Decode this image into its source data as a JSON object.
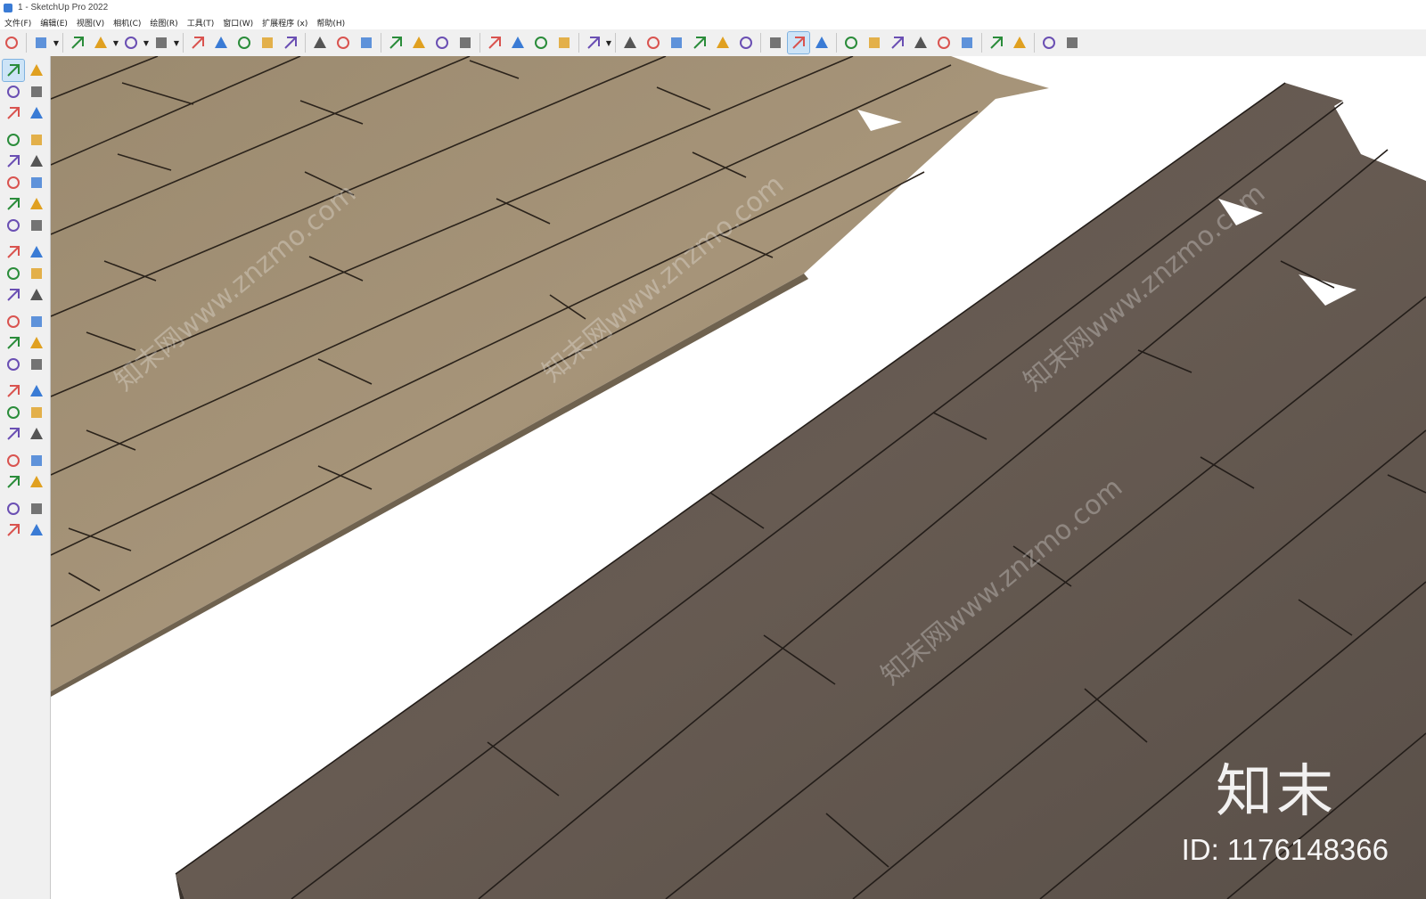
{
  "window": {
    "title": "1 - SketchUp Pro 2022"
  },
  "menu": [
    "文件(F)",
    "编辑(E)",
    "视图(V)",
    "相机(C)",
    "绘图(R)",
    "工具(T)",
    "窗口(W)",
    "扩展程序 (x)",
    "帮助(H)"
  ],
  "toolbar_icons": [
    "search-icon",
    "select-icon",
    "eraser-icon",
    "pencil-icon",
    "arc-icon",
    "rectangle-icon",
    "push-pull-icon",
    "follow-me-icon",
    "move-icon",
    "rotate-icon",
    "scale-icon",
    "tape-measure-icon",
    "text-icon",
    "paint-bucket-icon",
    "orbit-icon",
    "pan-icon",
    "zoom-icon",
    "zoom-extents-icon",
    "warehouse-icon",
    "extension-icon",
    "layers-icon",
    "styles-icon",
    "account-icon",
    "iso-view-icon",
    "front-view-icon",
    "home-view-icon",
    "top-view-icon",
    "right-view-icon",
    "back-view-icon",
    "component-icon",
    "section-icon",
    "scenes-icon",
    "add-icon",
    "solid-icon",
    "materials-icon",
    "checker-icon",
    "cloud-icon",
    "settings-icon",
    "outliner-icon",
    "info-icon",
    "cart-icon",
    "profile-icon"
  ],
  "sidebar_icons": [
    "select-icon",
    "orbit-icon",
    "paint-bucket-icon",
    "eraser-icon",
    "component-icon",
    "tag-icon",
    "line-icon",
    "freehand-icon",
    "rectangle-icon",
    "rotated-rectangle-icon",
    "circle-icon",
    "polygon-icon",
    "arc-icon",
    "two-point-arc-icon",
    "three-point-arc-icon",
    "pie-icon",
    "move-icon",
    "push-pull-icon",
    "rotate-icon",
    "follow-me-icon",
    "scale-icon",
    "offset-icon",
    "tape-measure-icon",
    "dimension-icon",
    "protractor-icon",
    "text-icon",
    "axes-icon",
    "3d-text-icon",
    "orbit-icon-2",
    "pan-icon",
    "zoom-icon",
    "zoom-window-icon",
    "zoom-extents-icon",
    "previous-view-icon",
    "position-camera-icon",
    "look-around-icon",
    "walk-icon",
    "section-plane-icon",
    "warehouse-icon",
    "extension-warehouse-icon",
    "layout-icon",
    "extension-manager-icon"
  ],
  "watermark": {
    "brand": "知末",
    "id": "ID: 1176148366",
    "diag": "知末网www.znzmo.com"
  },
  "colors": {
    "light_wood": "#a08f74",
    "dark_wood": "#5e534b",
    "accent": "#3a7bd5"
  }
}
